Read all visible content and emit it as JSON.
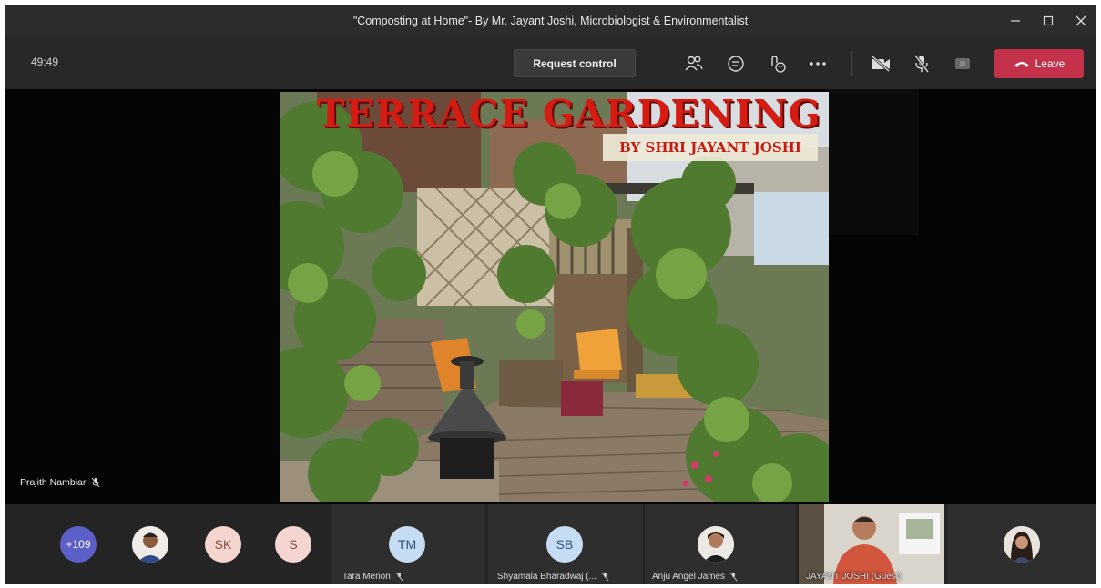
{
  "window": {
    "title": "\"Composting at Home\"- By Mr. Jayant Joshi, Microbiologist & Environmentalist",
    "controls": [
      "minimize-icon",
      "maximize-icon",
      "close-icon"
    ]
  },
  "toolbar": {
    "timer": "49:49",
    "request_control_label": "Request control",
    "icons": [
      "participants-icon",
      "chat-icon",
      "reactions-icon",
      "more-options-icon",
      "camera-off-icon",
      "mic-muted-icon",
      "share-tray-icon"
    ],
    "leave_label": "Leave",
    "leave_color": "#c4314b"
  },
  "stage": {
    "presenter_name": "Prajith Nambiar",
    "slide": {
      "title": "TERRACE GARDENING",
      "subtitle": "BY SHRI JAYANT JOSHI",
      "title_color": "#d51b12"
    }
  },
  "participants": {
    "overflow_count": "+109",
    "avatars": [
      {
        "initials": "SK",
        "color": "#f4d5cf",
        "text_color": "#8a4a40"
      },
      {
        "initials": "S",
        "color": "#f4d5cf",
        "text_color": "#8a4a40"
      }
    ],
    "tiles": [
      {
        "initials": "TM",
        "name": "Tara Menon",
        "color": "#c6dcf2",
        "text_color": "#2f4f7a"
      },
      {
        "initials": "SB",
        "name": "Shyamala Bharadwaj (...",
        "color": "#c6dcf2",
        "text_color": "#2f4f7a"
      },
      {
        "initials": "",
        "name": "Anju Angel James",
        "color": "#ffffff",
        "text_color": "#000000"
      },
      {
        "initials": "",
        "name": "JAYANT JOSHI (Guest)",
        "color": "#ffffff",
        "text_color": "#000000"
      }
    ]
  }
}
